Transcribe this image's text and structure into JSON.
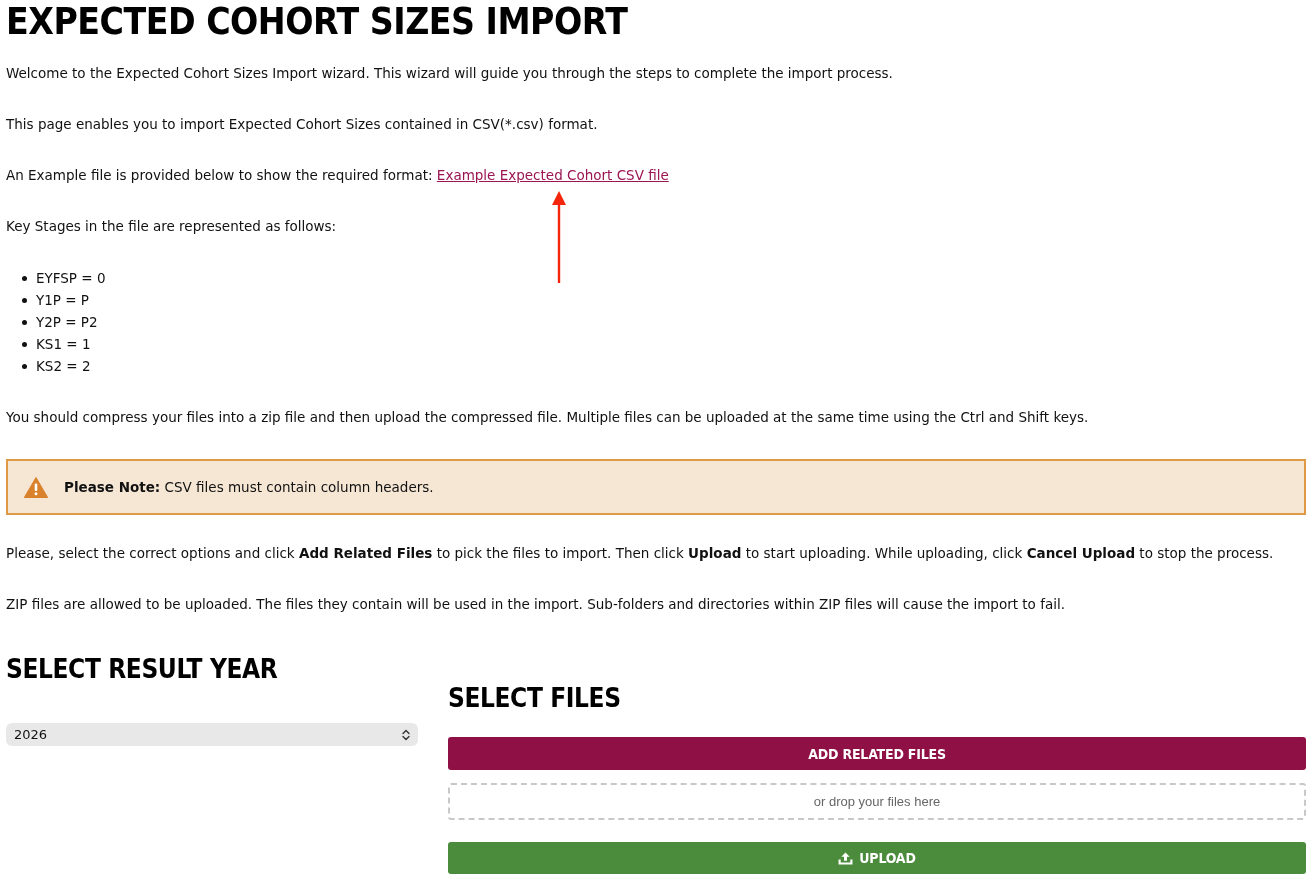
{
  "page_title": "EXPECTED COHORT SIZES IMPORT",
  "intro_paragraphs": [
    "Welcome to the Expected Cohort Sizes Import wizard. This wizard will guide you through the steps to complete the import process.",
    "This page enables you to import Expected Cohort Sizes contained in CSV(*.csv) format."
  ],
  "example_file": {
    "text": "An Example file is provided below to show the required format:",
    "link": "Example Expected Cohort CSV file",
    "highlighted": true
  },
  "key_stages": {
    "intro": "Key Stages in the file are represented as follows:",
    "items": [
      "EYFSP = 0",
      "Y1P = P",
      "Y2P = P2",
      "KS1 = 1",
      "KS2 = 2"
    ]
  },
  "compress_note": "You should compress your files into a zip file and then upload the compressed file. Multiple files can be uploaded at the same time using the Ctrl and Shift keys.",
  "alert": {
    "kind": "warning",
    "text": "**Please Note:** CSV files must contain column headers."
  },
  "instructions": "Please, select the correct options and click **Add Related Files** to pick the files to import. Then click **Upload** to start uploading. While uploading, click **Cancel Upload** to stop the process.",
  "zip_note": "ZIP files are allowed to be uploaded. The files they contain will be used in the import. Sub-folders and directories within ZIP files will cause the import to fail.",
  "result_year": {
    "heading": "SELECT RESULT YEAR",
    "select": {
      "value": "2026"
    }
  },
  "files": {
    "heading": "SELECT FILES",
    "add_button": "ADD RELATED FILES",
    "drop_zone": "or drop your files here",
    "upload_button": "UPLOAD"
  }
}
